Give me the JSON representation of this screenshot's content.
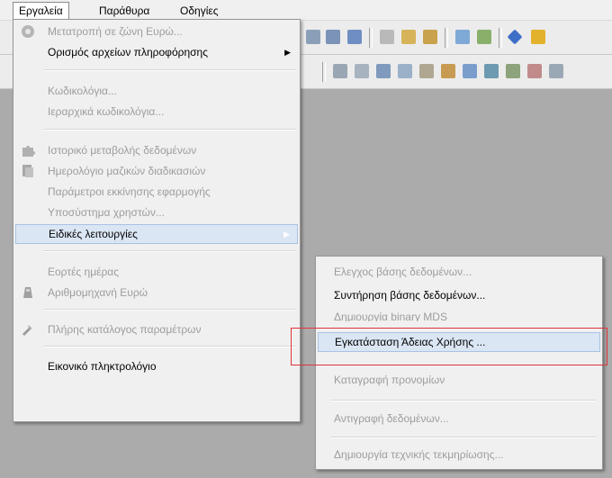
{
  "menubar": {
    "items": [
      {
        "label": "Εργαλεία"
      },
      {
        "label": "Παράθυρα"
      },
      {
        "label": "Οδηγίες"
      }
    ]
  },
  "tools_menu": {
    "items": [
      {
        "label": "Μετατροπή σε ζώνη Ευρώ...",
        "enabled": false,
        "icon": "euro-coin-icon"
      },
      {
        "label": "Ορισμός αρχείων πληροφόρησης",
        "enabled": true,
        "submenu": true
      },
      {
        "label": "Κωδικολόγια...",
        "enabled": false
      },
      {
        "label": "Ιεραρχικά κωδικολόγια...",
        "enabled": false
      },
      {
        "label": "Ιστορικό μεταβολής δεδομένων",
        "enabled": false,
        "icon": "puzzle-icon"
      },
      {
        "label": "Ημερολόγιο μαζικών διαδικασιών",
        "enabled": false,
        "icon": "document-icon"
      },
      {
        "label": "Παράμετροι εκκίνησης εφαρμογής",
        "enabled": false
      },
      {
        "label": "Υποσύστημα χρηστών...",
        "enabled": false
      },
      {
        "label": "Ειδικές λειτουργίες",
        "enabled": true,
        "submenu": true,
        "highlighted": true
      },
      {
        "label": "Εορτές ημέρας",
        "enabled": false
      },
      {
        "label": "Αριθμομηχανή Ευρώ",
        "enabled": false,
        "icon": "calculator-icon"
      },
      {
        "label": "Πλήρης κατάλογος παραμέτρων",
        "enabled": false,
        "icon": "tools-icon"
      },
      {
        "label": "Εικονικό πληκτρολόγιο",
        "enabled": true
      }
    ]
  },
  "special_submenu": {
    "items": [
      {
        "label": "Ελεγχος βάσης δεδομένων...",
        "enabled": false
      },
      {
        "label": "Συντήρηση βάσης δεδομένων...",
        "enabled": true
      },
      {
        "label": "Δημιουργία binary MDS",
        "enabled": false
      },
      {
        "label": "Εγκατάσταση Άδειας Χρήσης ...",
        "enabled": true,
        "highlighted": true
      },
      {
        "label": "Καταγραφή προνομίων",
        "enabled": false
      },
      {
        "label": "Αντιγραφή δεδομένων...",
        "enabled": false
      },
      {
        "label": "Δημιουργία τεχνικής τεκμηρίωσης...",
        "enabled": false
      }
    ]
  },
  "colors": {
    "highlight": "#dbe6f4",
    "highlight_border": "#a8c2e3",
    "annotation": "#e0343a",
    "disabled_text": "#9d9d9d"
  }
}
